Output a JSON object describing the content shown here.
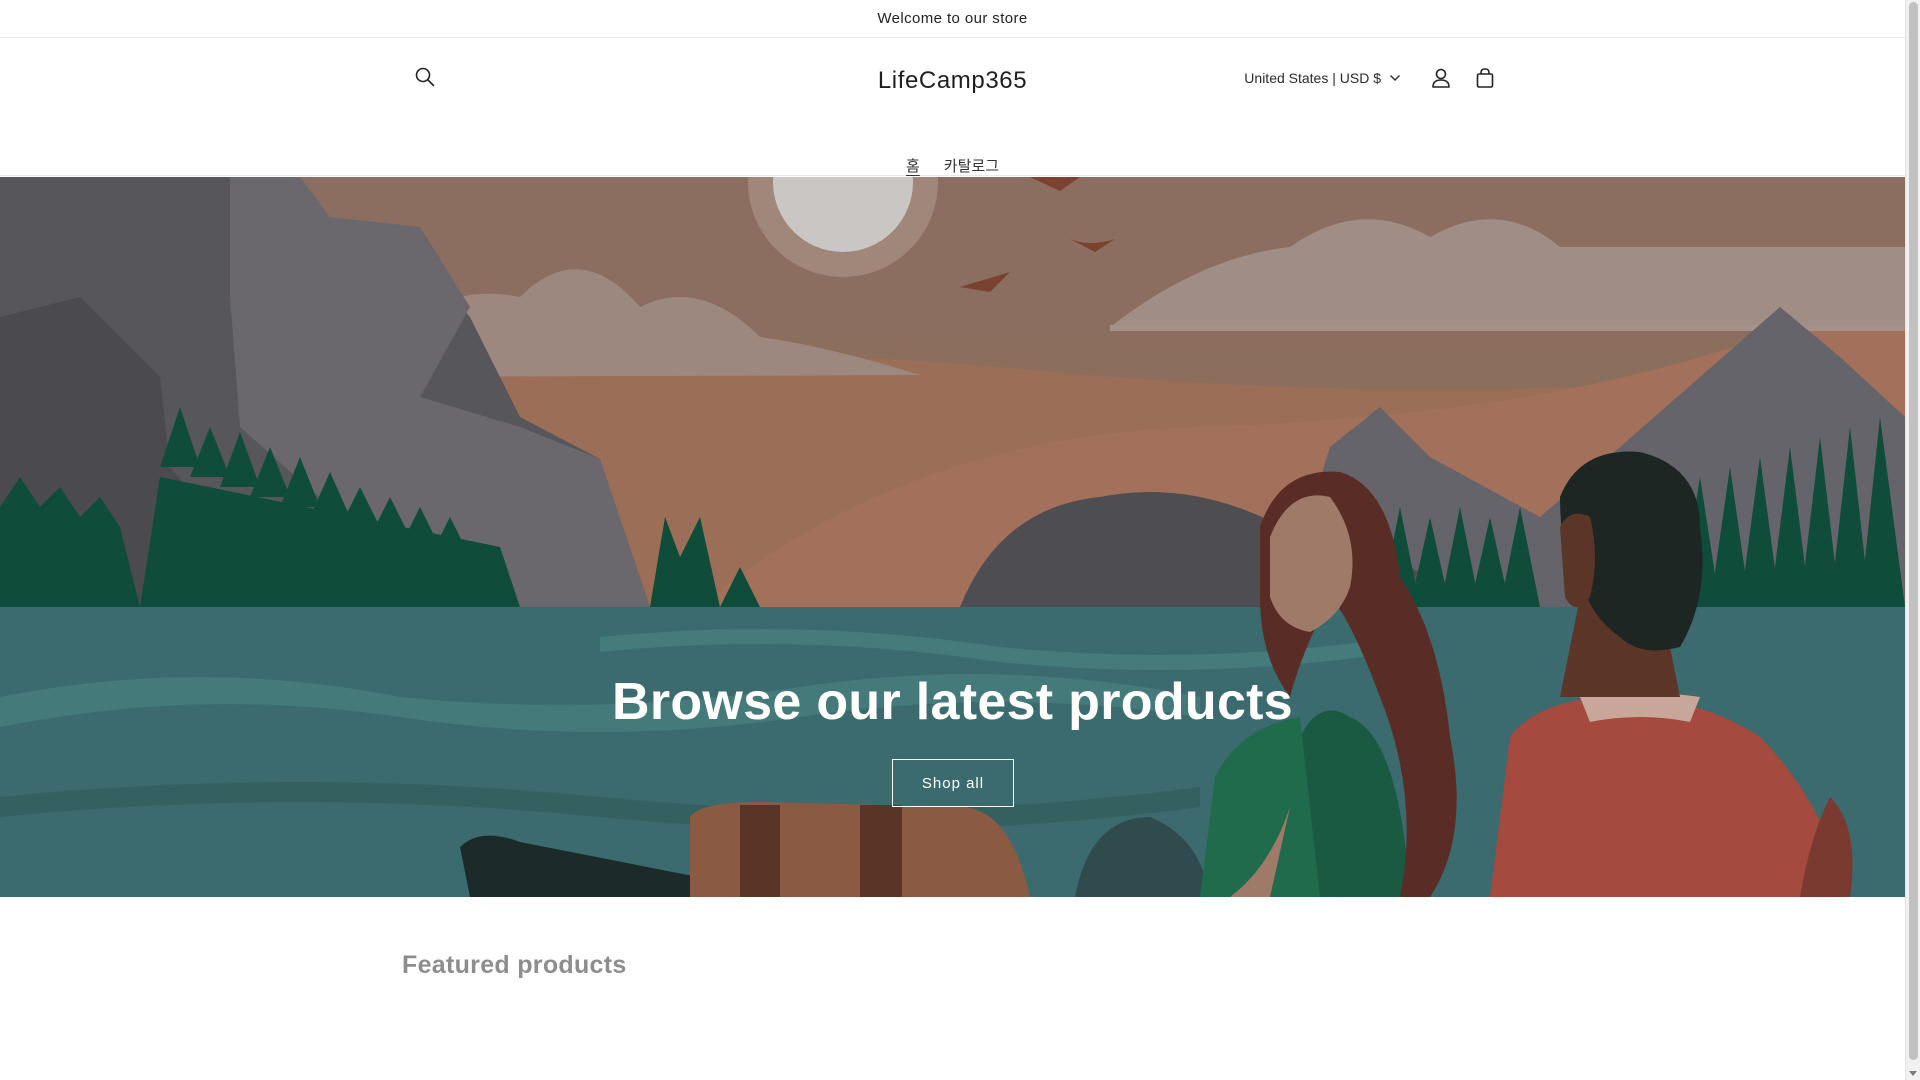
{
  "announcement": {
    "text": "Welcome to our store"
  },
  "header": {
    "logo": "LifeCamp365",
    "country_selector": "United States | USD $",
    "icons": {
      "search": "search-icon",
      "account": "user-icon",
      "cart": "cart-icon",
      "country_caret": "chevron-down-icon"
    }
  },
  "nav": {
    "items": [
      {
        "label": "홈",
        "active": true
      },
      {
        "label": "카탈로그",
        "active": false
      }
    ]
  },
  "hero": {
    "heading": "Browse our latest products",
    "button_label": "Shop all"
  },
  "featured": {
    "heading": "Featured products"
  },
  "colors": {
    "sky": "#8b6b5a",
    "water": "#3a6b6e",
    "mountain_gray": "#56555a",
    "tree_green": "#0e4d3a",
    "hero_text": "#ffffff"
  }
}
